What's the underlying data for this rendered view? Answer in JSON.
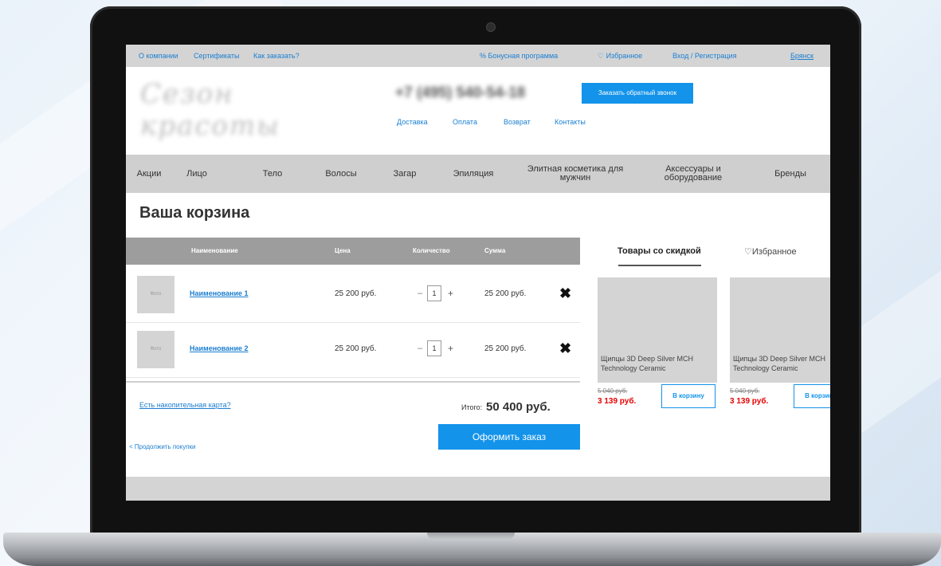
{
  "topbar": {
    "links": [
      "О компании",
      "Сертификаты",
      "Как заказать?"
    ],
    "bonus": "% Бонусная программа",
    "favorites": "♡ Избранное",
    "login": "Вход / Регистрация",
    "city": "Брянск"
  },
  "header": {
    "logo_text": "Сезон красоты",
    "phone": "+7 (495) 540-54-18",
    "callback_label": "Заказать обратный звонок",
    "subnav": [
      "Доставка",
      "Оплата",
      "Возврат",
      "Контакты"
    ]
  },
  "categories": [
    "Акции",
    "Лицо",
    "Тело",
    "Волосы",
    "Загар",
    "Эпиляция",
    "Элитная косметика для мужчин",
    "Аксессуары и оборудование",
    "Бренды"
  ],
  "page_title": "Ваша корзина",
  "cart": {
    "columns": [
      "Наименование",
      "Цена",
      "Количество",
      "Сумма"
    ],
    "thumb_label": "Фото",
    "items": [
      {
        "name": "Наименование 1",
        "price": "25 200 руб.",
        "qty": "1",
        "sum": "25 200 руб."
      },
      {
        "name": "Наименование 2",
        "price": "25 200 руб.",
        "qty": "1",
        "sum": "25 200 руб."
      }
    ],
    "minus": "–",
    "plus": "+",
    "remove": "✖",
    "loyalty_link": "Есть накопительная карта?",
    "total_label": "Итого:",
    "total_value": "50 400 руб.",
    "checkout_label": "Оформить заказ",
    "continue_link": "< Продолжить покупки"
  },
  "sidebar": {
    "tab_discount": "Товары со скидкой",
    "tab_favorites": "♡Избранное",
    "products": [
      {
        "name": "Щипцы 3D Deep Silver MCH Technology Ceramic",
        "old_price": "5 040 руб.",
        "new_price": "3 139 руб.",
        "cart_label": "В корзину"
      },
      {
        "name": "Щипцы 3D Deep Silver MCH Technology Ceramic",
        "old_price": "5 040 руб.",
        "new_price": "3 139 руб.",
        "cart_label": "В корзину"
      }
    ]
  },
  "colors": {
    "accent": "#1393ea",
    "sale_price": "#e60000",
    "header_gray": "#9d9d9d"
  }
}
